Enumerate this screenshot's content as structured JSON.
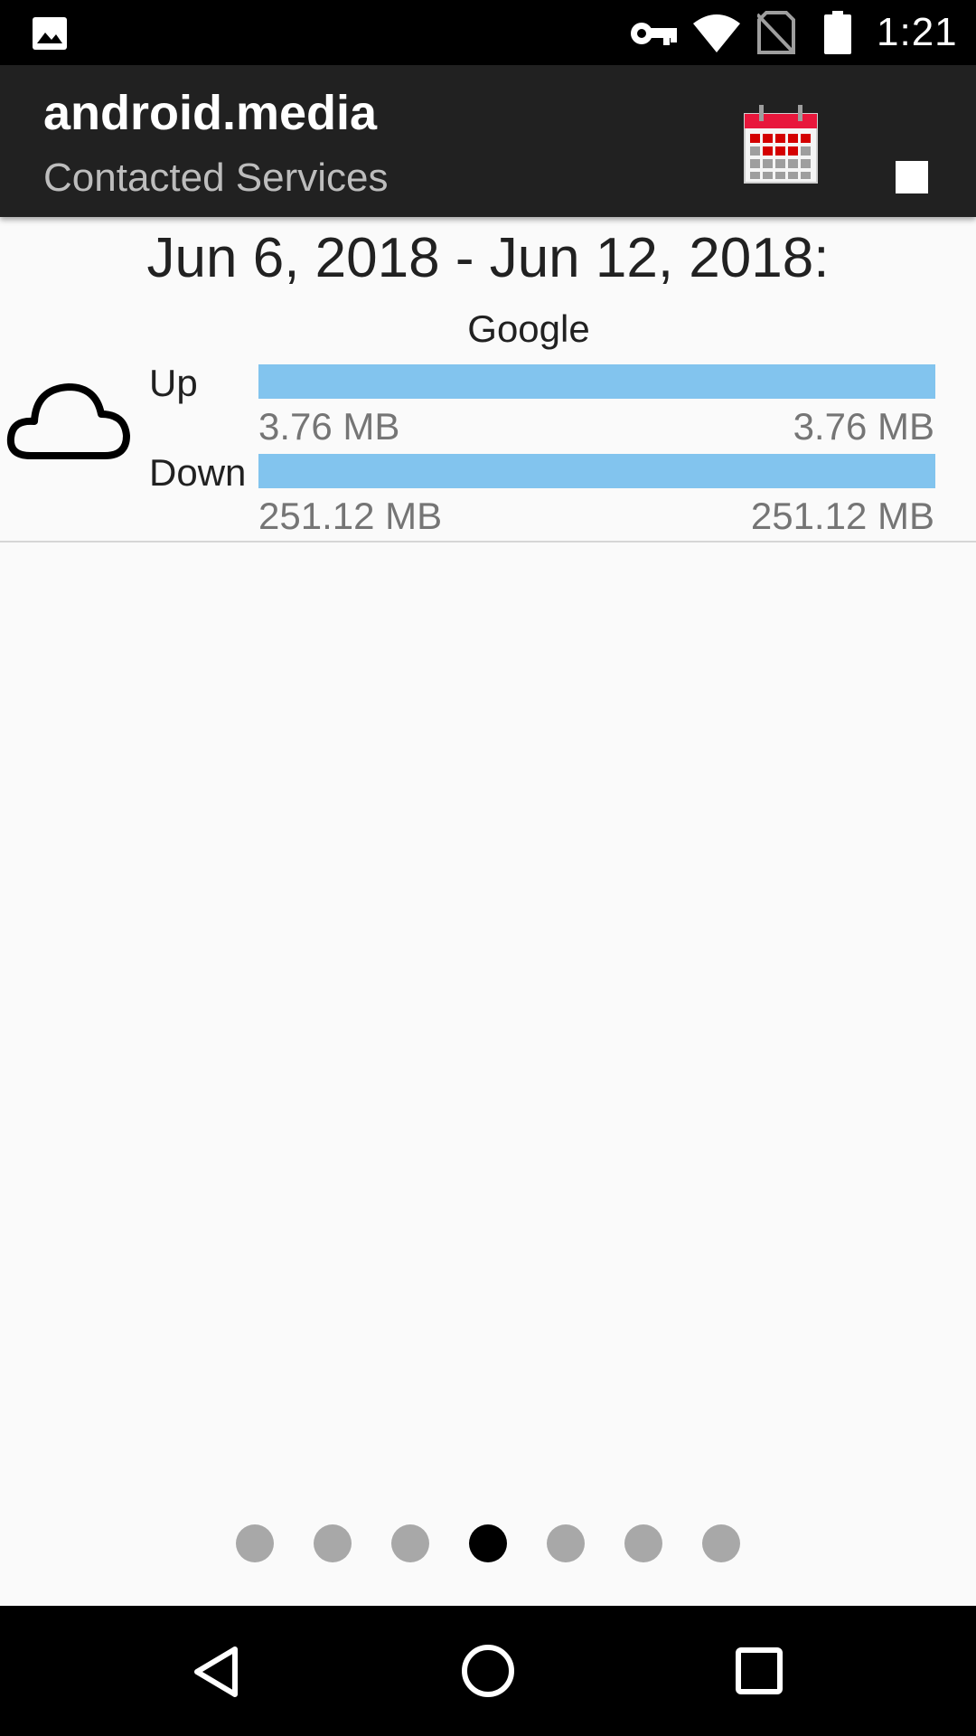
{
  "status_bar": {
    "time": "1:21",
    "icons": [
      "image-icon",
      "vpn-key-icon",
      "wifi-icon",
      "no-sim-icon",
      "battery-icon"
    ]
  },
  "app_bar": {
    "title": "android.media",
    "subtitle": "Contacted Services",
    "actions": [
      "calendar-icon",
      "stop-icon"
    ]
  },
  "content": {
    "date_range": "Jun 6, 2018 - Jun 12, 2018:",
    "service": {
      "name": "Google",
      "icon": "cloud-icon",
      "up": {
        "label": "Up",
        "value": "3.76 MB",
        "total": "3.76 MB",
        "fraction": 1.0
      },
      "down": {
        "label": "Down",
        "value": "251.12 MB",
        "total": "251.12 MB",
        "fraction": 1.0
      }
    }
  },
  "pager": {
    "count": 7,
    "active_index": 3
  },
  "nav_bar": {
    "buttons": [
      "back-icon",
      "home-icon",
      "recents-icon"
    ]
  },
  "colors": {
    "bar_fill": "#82c4ee",
    "app_bar": "#212121",
    "calendar_red": "#e8173c"
  }
}
